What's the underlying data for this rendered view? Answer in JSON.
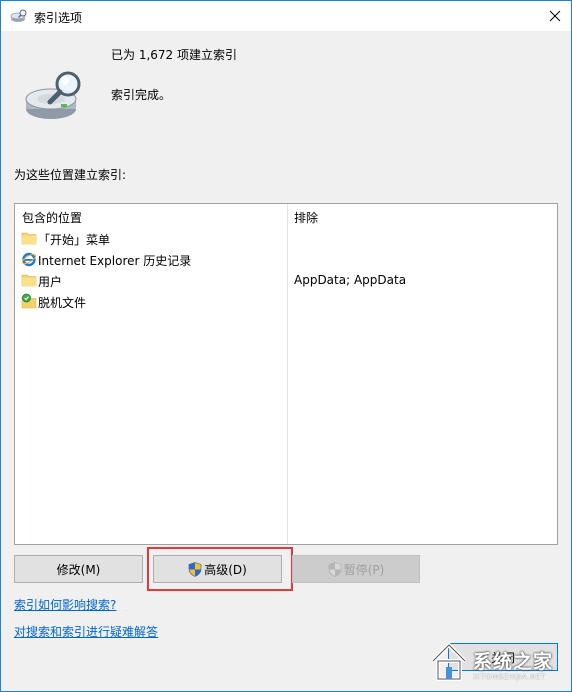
{
  "window": {
    "title": "索引选项"
  },
  "status": {
    "count_text": "已为 1,672 项建立索引",
    "state_text": "索引完成。"
  },
  "locations_section": {
    "label": "为这些位置建立索引:",
    "columns": {
      "included": "包含的位置",
      "excluded": "排除"
    },
    "rows": [
      {
        "name": "「开始」菜单",
        "exclude": "",
        "icon": "folder-icon"
      },
      {
        "name": "Internet Explorer 历史记录",
        "exclude": "",
        "icon": "internet-explorer-icon"
      },
      {
        "name": "用户",
        "exclude": "AppData; AppData",
        "icon": "folder-icon"
      },
      {
        "name": "脱机文件",
        "exclude": "",
        "icon": "offline-files-icon"
      }
    ]
  },
  "buttons": {
    "modify": "修改(M)",
    "advanced": "高级(D)",
    "pause": "暂停(P)",
    "close": "关闭"
  },
  "links": {
    "how_affects": "索引如何影响搜索?",
    "troubleshoot": "对搜索和索引进行疑难解答"
  },
  "watermark": {
    "text": "系统之家",
    "sub": "XITONGZHIJIA.NET"
  },
  "colors": {
    "accent_border": "#1883d7",
    "link": "#0066cc",
    "highlight": "#e03a3a"
  }
}
